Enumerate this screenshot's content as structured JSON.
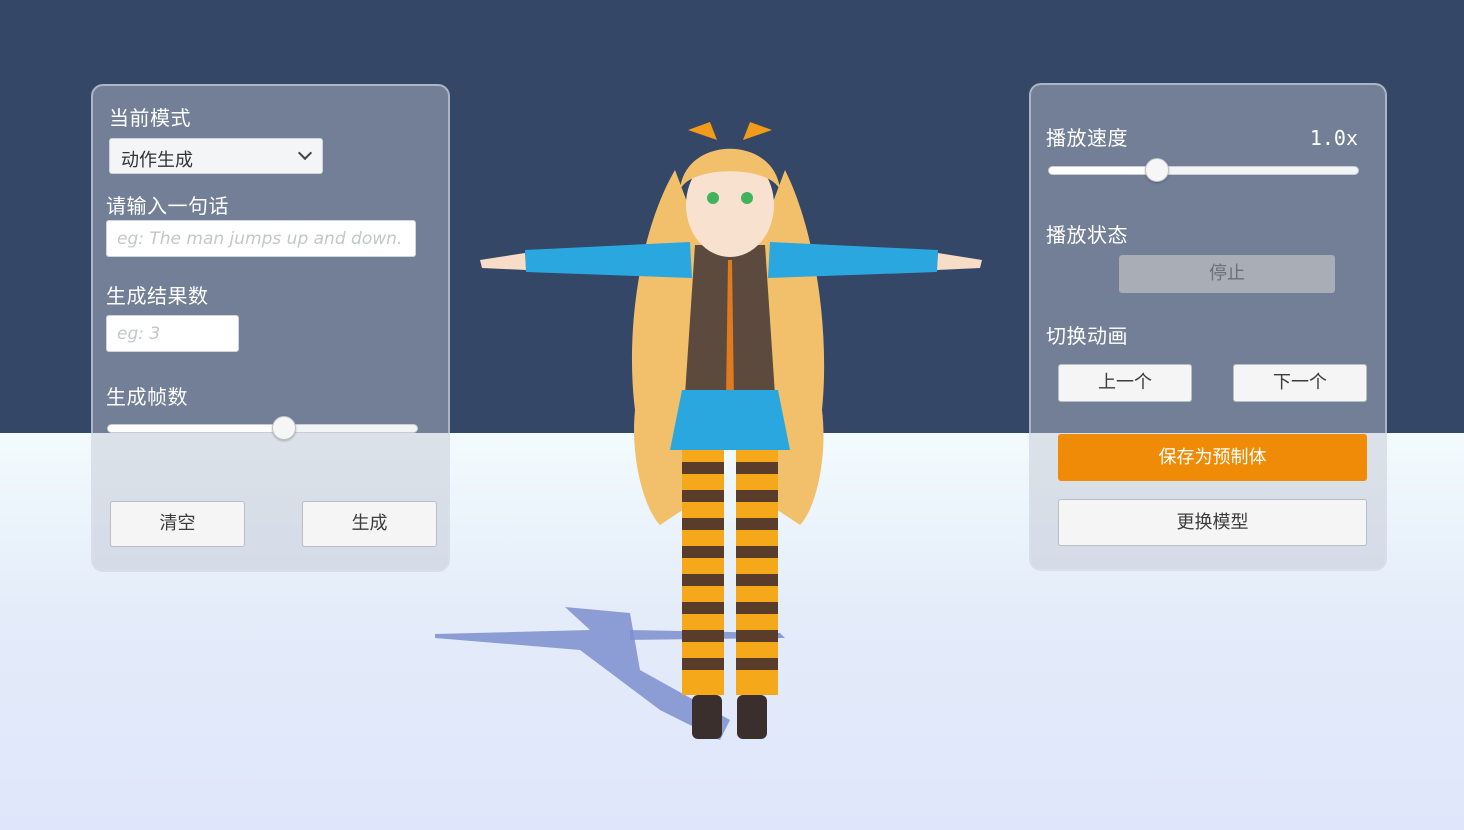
{
  "left_panel": {
    "mode_label": "当前模式",
    "mode_value": "动作生成",
    "sentence_label": "请输入一句话",
    "sentence_placeholder": "eg: The man jumps up and down.",
    "result_count_label": "生成结果数",
    "result_count_placeholder": "eg: 3",
    "frames_label": "生成帧数",
    "frames_slider_fraction": 0.57,
    "clear_button": "清空",
    "generate_button": "生成"
  },
  "right_panel": {
    "speed_label": "播放速度",
    "speed_value": "1.0x",
    "speed_slider_fraction": 0.35,
    "state_label": "播放状态",
    "stop_button": "停止",
    "switch_label": "切换动画",
    "prev_button": "上一个",
    "next_button": "下一个",
    "save_prefab_button": "保存为预制体",
    "change_model_button": "更换模型"
  },
  "colors": {
    "sky": "#344767",
    "accent": "#ef8b06",
    "panel_label": "#ffffff"
  }
}
